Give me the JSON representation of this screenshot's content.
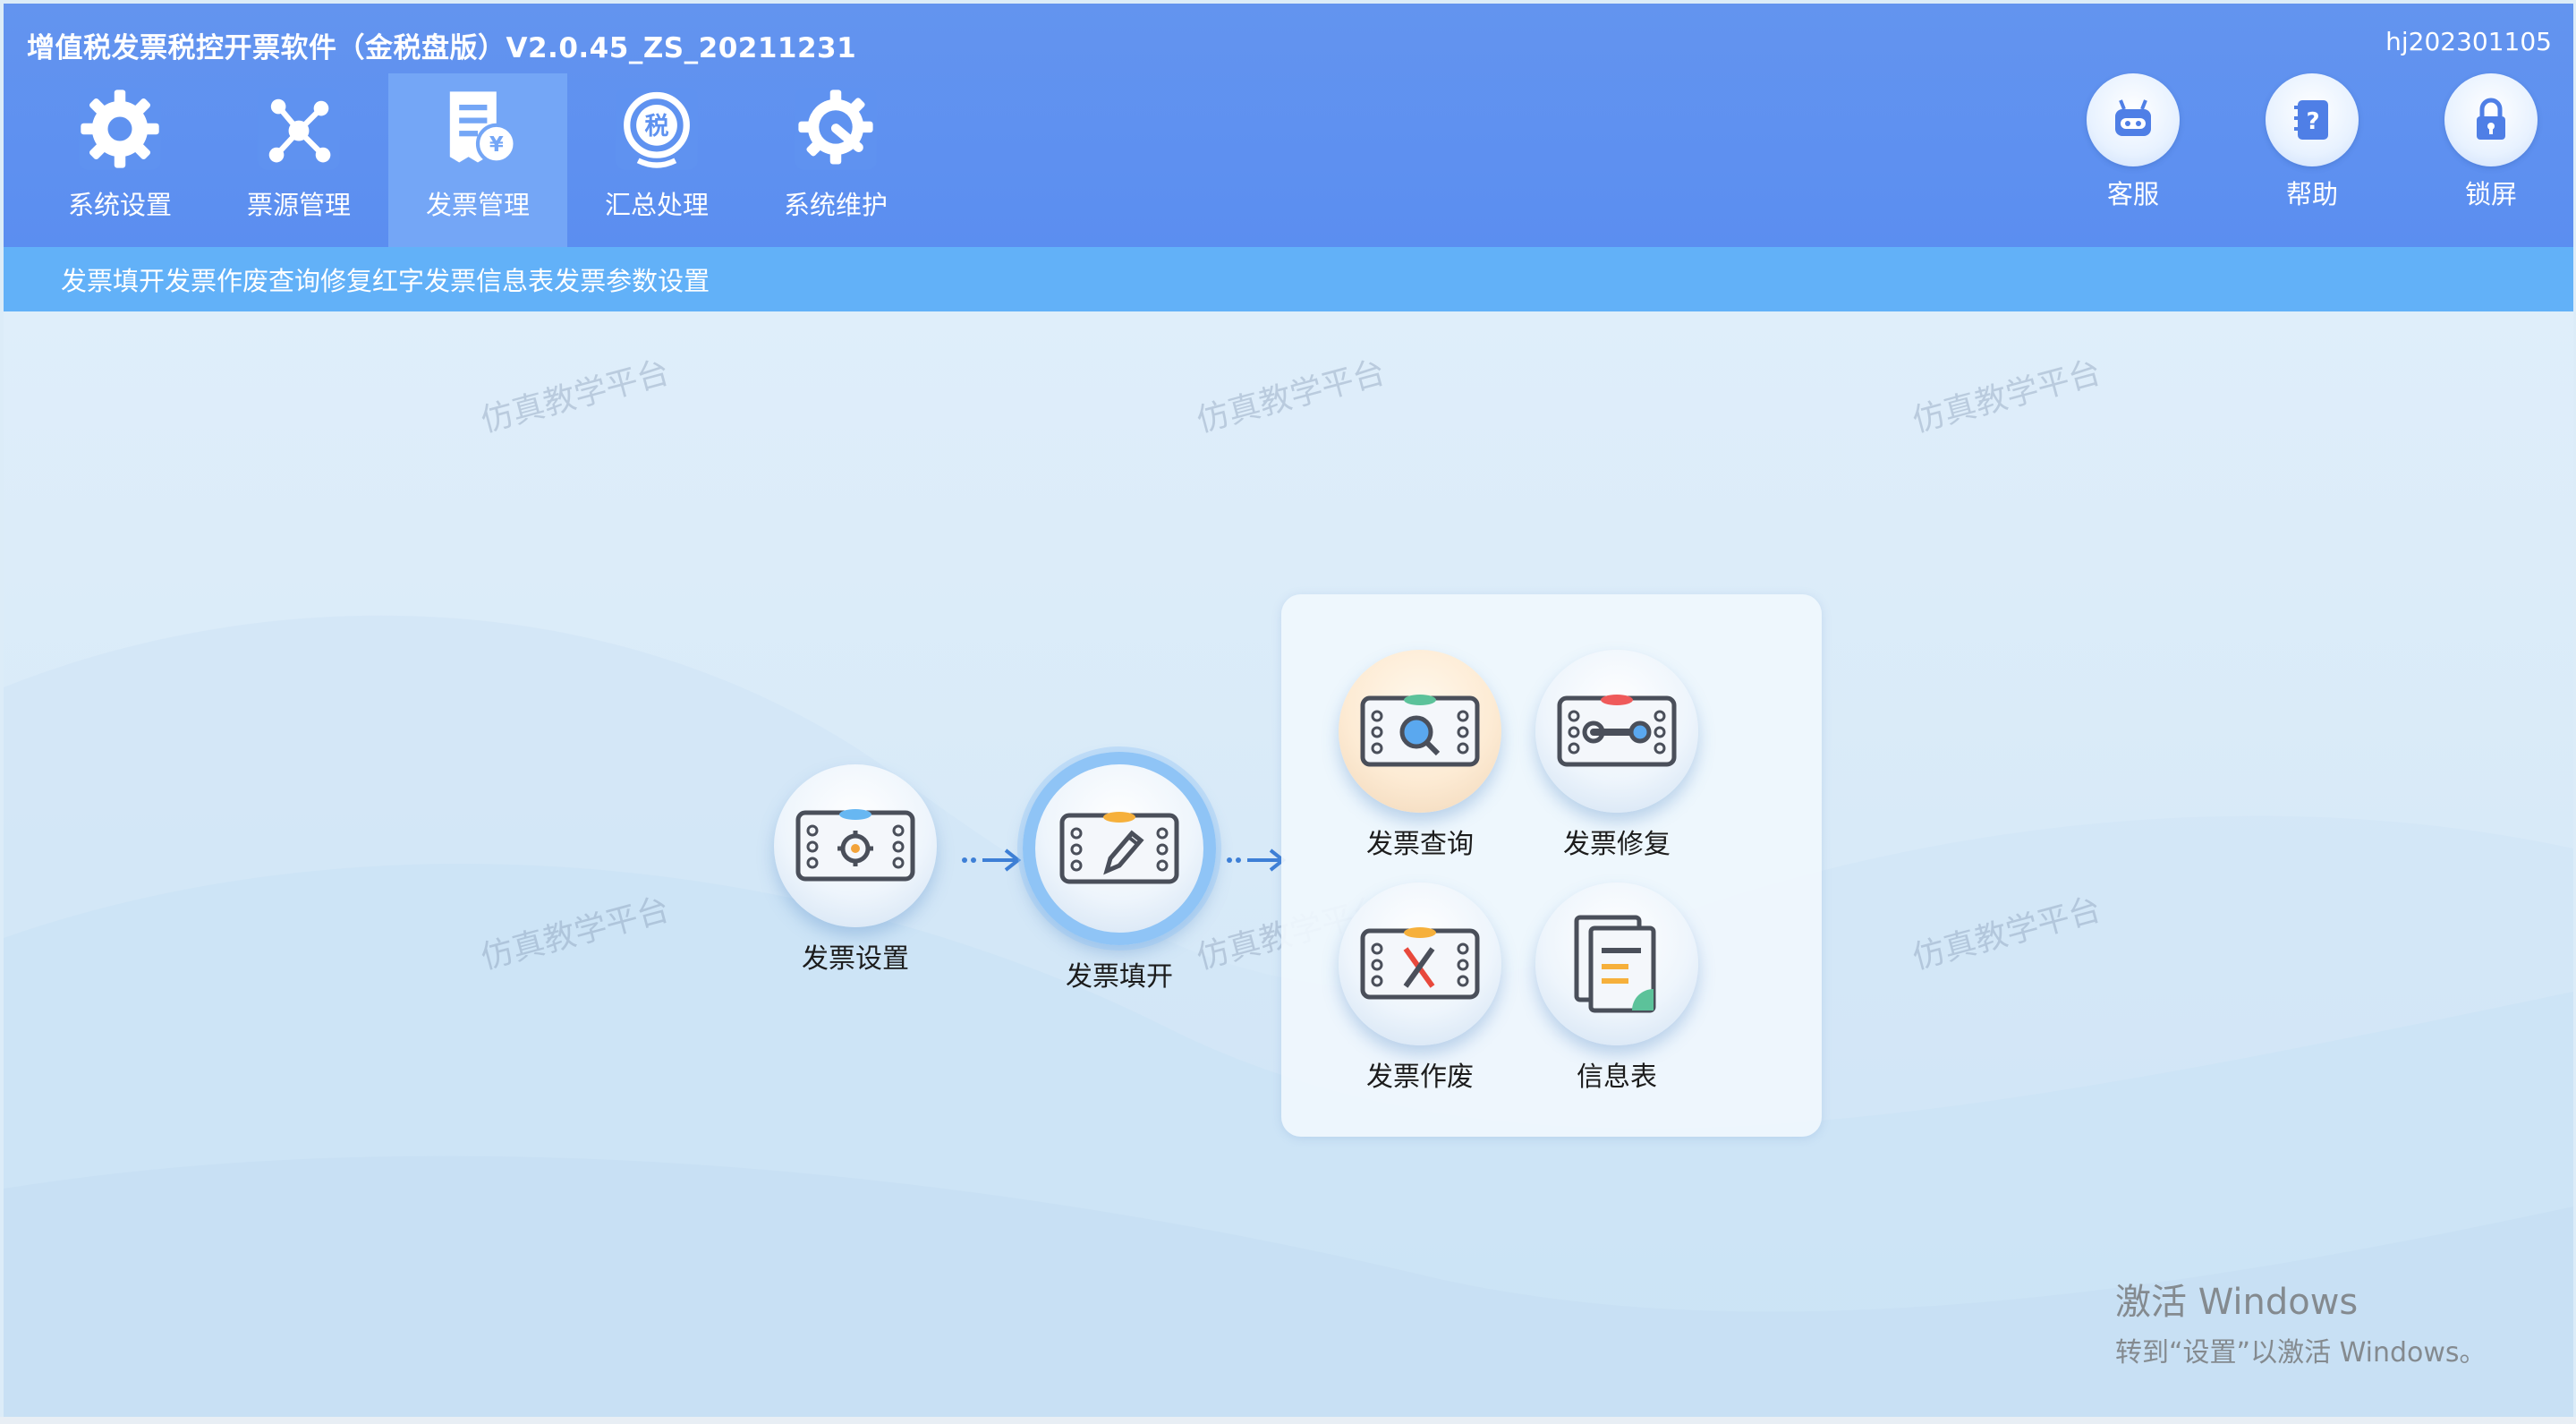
{
  "app": {
    "title": "增值税发票税控开票软件（金税盘版）V2.0.45_ZS_20211231",
    "account": "hj202301105"
  },
  "nav": {
    "items": [
      {
        "label": "系统设置",
        "icon": "gear-icon"
      },
      {
        "label": "票源管理",
        "icon": "network-icon"
      },
      {
        "label": "发票管理",
        "icon": "invoice-icon",
        "active": true
      },
      {
        "label": "汇总处理",
        "icon": "tax-summary-icon"
      },
      {
        "label": "系统维护",
        "icon": "wrench-gear-icon"
      }
    ]
  },
  "tools": {
    "items": [
      {
        "label": "客服",
        "icon": "robot-icon"
      },
      {
        "label": "帮助",
        "icon": "help-book-icon"
      },
      {
        "label": "锁屏",
        "icon": "lock-icon"
      }
    ]
  },
  "subnav": {
    "items": [
      "发票填开",
      "发票作废",
      "查询修复",
      "红字发票信息表",
      "发票参数设置"
    ]
  },
  "watermark": "仿真教学平台",
  "flow": {
    "setup": "发票设置",
    "fill": "发票填开",
    "query": "发票查询",
    "repair": "发票修复",
    "void": "发票作废",
    "info": "信息表"
  },
  "activation": {
    "line1": "激活 Windows",
    "line2": "转到“设置”以激活 Windows。"
  },
  "colors": {
    "header": "#5b8ef0",
    "subbar": "#62b1f8",
    "active_tab": "#74a6f6",
    "accent_arrow": "#3d7fd6"
  }
}
